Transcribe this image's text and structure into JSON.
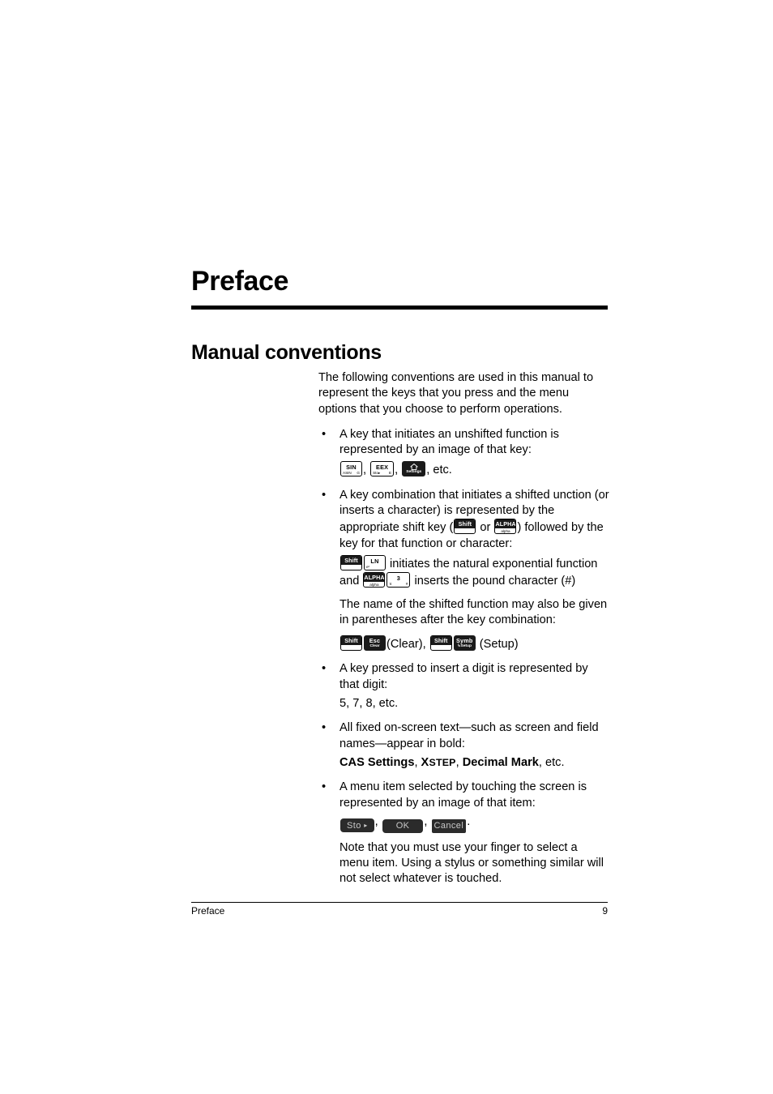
{
  "page": {
    "chapter_title": "Preface",
    "section_title": "Manual conventions"
  },
  "intro": {
    "text": "The following conventions are used in this manual to represent the keys that you press and the menu options that you choose to perform operations."
  },
  "bullets": {
    "b1": {
      "marker": "•",
      "text": "A key that initiates an unshifted function is represented by an image of that key:",
      "etc": ", etc.",
      "sep": ", "
    },
    "b2": {
      "marker": "•",
      "text_part1": "A key combination that initiates a shifted unction (or inserts a character) is represented by the appropriate shift key (",
      "text_or": " or ",
      "text_part2": ") followed by the key for that function or character:"
    },
    "b3": {
      "marker": "•",
      "text": "A key pressed to insert a digit is represented by that digit:",
      "example": "5, 7, 8, etc."
    },
    "b4": {
      "marker": "•",
      "text": "All fixed on-screen text—such as screen and field names—appear in bold:",
      "bold_example_1": "CAS Settings",
      "bold_example_2_first": "X",
      "bold_example_2_rest": "STEP",
      "bold_example_3": "Decimal Mark",
      "sep": ", ",
      "etc": ", etc."
    },
    "b5": {
      "marker": "•",
      "text": "A menu item selected by touching the screen is represented by an image of that item:",
      "sep": ", ",
      "period": "."
    }
  },
  "shifted_example": {
    "line1_text": " initiates the natural exponential function",
    "line2_prefix": "and ",
    "line2_text": " inserts the pound character (#)"
  },
  "parenthetical": {
    "text": "The name of the shifted function may also be given in parentheses after the key combination:",
    "clear_label": "(Clear),",
    "setup_label": "(Setup)"
  },
  "note": {
    "text": "Note that you must use your finger to select a menu item. Using a stylus or something similar will not select whatever is touched."
  },
  "keys": {
    "sin": {
      "main": "SIN",
      "sub_left": "ASIN",
      "sub_right": "G"
    },
    "eex": {
      "main": "EEX",
      "sub_left": "Sto▸",
      "sub_right": "E"
    },
    "settings": {
      "main": "Settings",
      "icon": "home-icon"
    },
    "shift": {
      "main": "Shift"
    },
    "alpha": {
      "main": "ALPHA",
      "sub": "alpha"
    },
    "ln": {
      "main": "LN",
      "sub_left": "eˣ"
    },
    "three": {
      "main": "3",
      "sub_left": "π",
      "sub_right": "#"
    },
    "esc": {
      "main": "Esc",
      "sub": "Clear"
    },
    "symb": {
      "main": "Symb",
      "sub": "↳Setup"
    }
  },
  "menu_buttons": {
    "sto": {
      "label": "Sto",
      "arrow": "▸"
    },
    "ok": {
      "label": "OK"
    },
    "cancel": {
      "label": "Cancel"
    }
  },
  "footer": {
    "left": "Preface",
    "page_number": "9"
  }
}
